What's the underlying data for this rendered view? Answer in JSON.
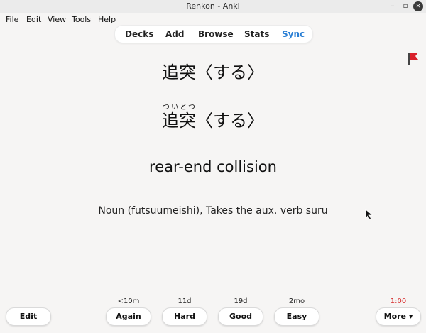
{
  "window": {
    "title": "Renkon - Anki"
  },
  "menu": [
    "File",
    "Edit",
    "View",
    "Tools",
    "Help"
  ],
  "tabs": [
    {
      "label": "Decks",
      "active": false
    },
    {
      "label": "Add",
      "active": false
    },
    {
      "label": "Browse",
      "active": false
    },
    {
      "label": "Stats",
      "active": false
    },
    {
      "label": "Sync",
      "active": true
    }
  ],
  "card": {
    "front": "追突〈する〉",
    "back_kanji": "追突",
    "back_reading": "ついとつ",
    "back_rest": "〈する〉",
    "meaning": "rear-end collision",
    "part_of_speech": "Noun (futsuumeishi), Takes the aux. verb suru"
  },
  "answer": {
    "edit_label": "Edit",
    "buttons": [
      {
        "label": "Again",
        "interval": "<10m"
      },
      {
        "label": "Hard",
        "interval": "11d"
      },
      {
        "label": "Good",
        "interval": "19d"
      },
      {
        "label": "Easy",
        "interval": "2mo"
      }
    ],
    "more_label": "More ▾",
    "timer": "1:00"
  },
  "colors": {
    "sync_active": "#2a7fd4",
    "flag": "#d9202a",
    "timer": "#d62b2b"
  }
}
